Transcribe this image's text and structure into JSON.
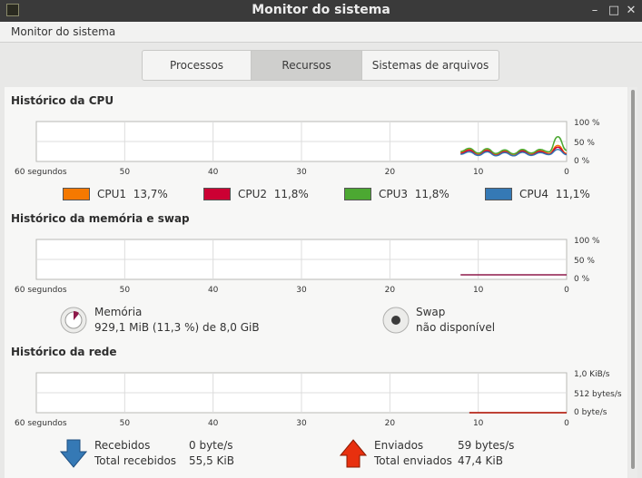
{
  "window": {
    "title": "Monitor do sistema"
  },
  "menubar": {
    "app_menu": "Monitor do sistema"
  },
  "tabs": [
    {
      "label": "Processos",
      "active": false
    },
    {
      "label": "Recursos",
      "active": true
    },
    {
      "label": "Sistemas de arquivos",
      "active": false
    }
  ],
  "cpu": {
    "title": "Histórico da CPU",
    "x_ticks": [
      "60 segundos",
      "50",
      "40",
      "30",
      "20",
      "10",
      "0"
    ],
    "y_ticks": [
      "100 %",
      "50 %",
      "0 %"
    ],
    "legend": [
      {
        "name": "CPU1",
        "value": "13,7%",
        "color": "#f57900"
      },
      {
        "name": "CPU2",
        "value": "11,8%",
        "color": "#cc0033"
      },
      {
        "name": "CPU3",
        "value": "11,8%",
        "color": "#4ca832"
      },
      {
        "name": "CPU4",
        "value": "11,1%",
        "color": "#3579b5"
      }
    ]
  },
  "memory": {
    "title": "Histórico da memória e swap",
    "x_ticks": [
      "60 segundos",
      "50",
      "40",
      "30",
      "20",
      "10",
      "0"
    ],
    "y_ticks": [
      "100 %",
      "50 %",
      "0 %"
    ],
    "mem_label": "Memória",
    "mem_value": "929,1 MiB (11,3 %) de 8,0 GiB",
    "mem_color": "#8e1a4a",
    "swap_label": "Swap",
    "swap_value": "não disponível"
  },
  "network": {
    "title": "Histórico da rede",
    "x_ticks": [
      "60 segundos",
      "50",
      "40",
      "30",
      "20",
      "10",
      "0"
    ],
    "y_ticks": [
      "1,0 KiB/s",
      "512 bytes/s",
      "0 byte/s"
    ],
    "received_label": "Recebidos",
    "received_value": "0 byte/s",
    "total_received_label": "Total recebidos",
    "total_received_value": "55,5 KiB",
    "sent_label": "Enviados",
    "sent_value": "59 bytes/s",
    "total_sent_label": "Total enviados",
    "total_sent_value": "47,4 KiB",
    "received_color": "#3579b5",
    "sent_color": "#cc1b00"
  },
  "chart_data": [
    {
      "type": "line",
      "title": "Histórico da CPU",
      "xlabel": "segundos",
      "ylabel": "%",
      "xlim": [
        60,
        0
      ],
      "ylim": [
        0,
        100
      ],
      "x": [
        12,
        11,
        10,
        9,
        8,
        7,
        6,
        5,
        4,
        3,
        2,
        1,
        0
      ],
      "series": [
        {
          "name": "CPU1",
          "values": [
            22,
            30,
            18,
            29,
            17,
            26,
            16,
            28,
            18,
            27,
            20,
            40,
            20
          ]
        },
        {
          "name": "CPU2",
          "values": [
            20,
            28,
            16,
            27,
            15,
            24,
            14,
            26,
            16,
            25,
            18,
            36,
            18
          ]
        },
        {
          "name": "CPU3",
          "values": [
            25,
            33,
            21,
            32,
            20,
            29,
            19,
            30,
            21,
            30,
            24,
            62,
            28
          ]
        },
        {
          "name": "CPU4",
          "values": [
            18,
            24,
            15,
            24,
            14,
            22,
            14,
            23,
            15,
            22,
            17,
            30,
            17
          ]
        }
      ]
    },
    {
      "type": "line",
      "title": "Histórico da memória e swap",
      "xlim": [
        60,
        0
      ],
      "ylim": [
        0,
        100
      ],
      "x": [
        12,
        0
      ],
      "series": [
        {
          "name": "Memória",
          "values": [
            11.3,
            11.3
          ]
        }
      ]
    },
    {
      "type": "line",
      "title": "Histórico da rede",
      "xlim": [
        60,
        0
      ],
      "ylim": [
        0,
        1024
      ],
      "x": [
        11,
        0
      ],
      "series": [
        {
          "name": "Recebidos",
          "values": [
            0,
            0
          ]
        },
        {
          "name": "Enviados",
          "values": [
            0,
            0
          ]
        }
      ]
    }
  ]
}
